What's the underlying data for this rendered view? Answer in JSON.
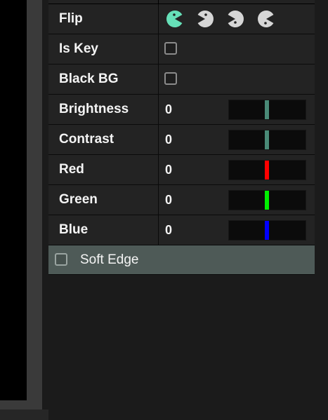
{
  "properties": {
    "flip": {
      "label": "Flip",
      "icons": [
        "pacman-right-icon",
        "pacman-left-icon",
        "pacman-up-icon",
        "pacman-down-icon"
      ]
    },
    "is_key": {
      "label": "Is Key",
      "checked": false
    },
    "black_bg": {
      "label": "Black BG",
      "checked": false
    },
    "brightness": {
      "label": "Brightness",
      "value": "0",
      "slider_color": "#4a8a77"
    },
    "contrast": {
      "label": "Contrast",
      "value": "0",
      "slider_color": "#4a8a77"
    },
    "red": {
      "label": "Red",
      "value": "0",
      "slider_color": "#ff0000"
    },
    "green": {
      "label": "Green",
      "value": "0",
      "slider_color": "#00ee00"
    },
    "blue": {
      "label": "Blue",
      "value": "0",
      "slider_color": "#0000ff"
    }
  },
  "soft_edge": {
    "label": "Soft Edge",
    "checked": false
  },
  "colors": {
    "flip_active": "#66e0b8",
    "flip_inactive": "#d6d6d6"
  }
}
